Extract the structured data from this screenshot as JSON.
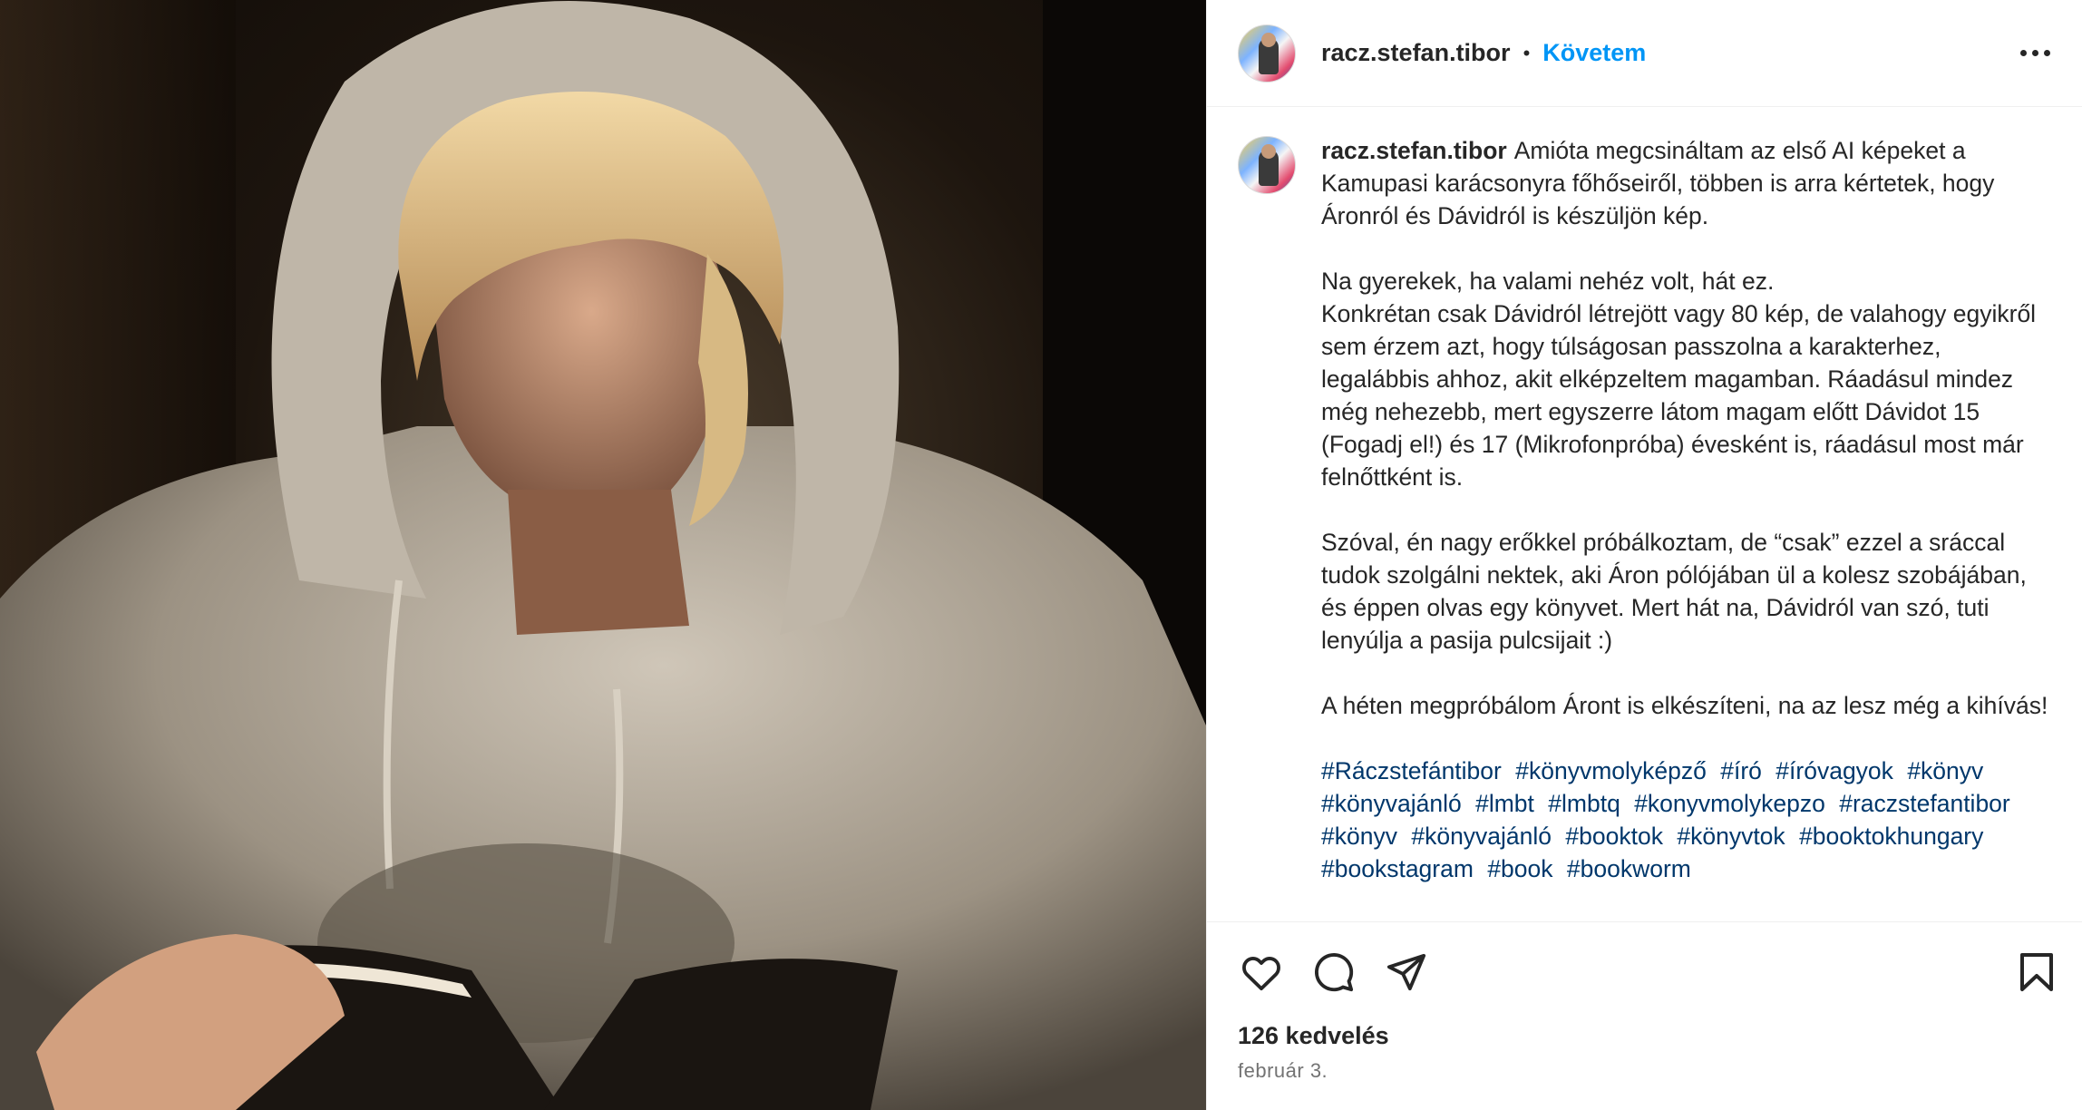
{
  "post": {
    "username": "racz.stefan.tibor",
    "separator": "•",
    "follow_label": "Követem",
    "caption": {
      "username": "racz.stefan.tibor",
      "paragraphs": [
        "Amióta megcsináltam az első AI képeket a Kamupasi karácsonyra főhőseiről, többen is arra kértetek, hogy Áronról és Dávidról is készüljön kép.",
        "Na gyerekek, ha valami nehéz volt, hát ez.\nKonkrétan csak Dávidról létrejött vagy 80 kép, de valahogy egyikről sem érzem azt, hogy túlságosan passzolna a karakterhez, legalábbis ahhoz, akit elképzeltem magamban. Ráadásul mindez még nehezebb, mert egyszerre látom magam előtt Dávidot 15 (Fogadj el!) és 17 (Mikrofonpróba) évesként is, ráadásul most már felnőttként is.",
        "Szóval, én nagy erőkkel próbálkoztam, de “csak” ezzel a sráccal tudok szolgálni nektek, aki Áron pólójában ül a kolesz szobájában, és éppen olvas egy könyvet. Mert hát na, Dávidról van szó, tuti lenyúlja a pasija pulcsijait :)",
        "A héten megpróbálom Áront is elkészíteni, na az lesz még a kihívás!"
      ],
      "hashtags": [
        "#Ráczstefántibor",
        "#könyvmolyképző",
        "#író",
        "#íróvagyok",
        "#könyv",
        "#könyvajánló",
        "#lmbt",
        "#lmbtq",
        "#konyvmolykepzo",
        "#raczstefantibor",
        "#könyv",
        "#könyvajánló",
        "#booktok",
        "#könyvtok",
        "#booktokhungary",
        "#bookstagram",
        "#book",
        "#bookworm"
      ]
    },
    "likes": "126 kedvelés",
    "date": "február 3."
  },
  "icons": {
    "more": "more-options-icon",
    "like": "heart-icon",
    "comment": "comment-icon",
    "share": "share-icon",
    "save": "bookmark-icon"
  },
  "colors": {
    "accent": "#0095f6",
    "hashtag": "#00376b",
    "text": "#262626",
    "secondary": "#737373"
  }
}
